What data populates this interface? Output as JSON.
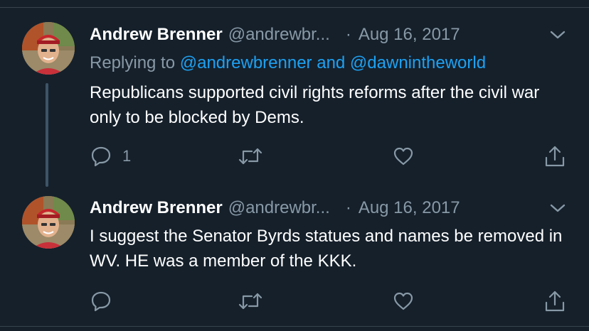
{
  "colors": {
    "background": "#15202b",
    "text": "#ffffff",
    "secondary": "#8899a6",
    "link": "#1da1f2",
    "divider": "#38444d"
  },
  "tweets": [
    {
      "name": "Andrew Brenner",
      "handle": "@andrewbr...",
      "separator": "·",
      "date": "Aug 16, 2017",
      "replying_prefix": "Replying to",
      "replying_users": "@andrewbrenner and @dawnintheworld",
      "text": "Republicans supported civil rights reforms after the civil war only to be blocked by Dems.",
      "reply_count": "1",
      "icons": [
        "avatar",
        "chevron-down-icon",
        "reply-icon",
        "retweet-icon",
        "like-icon",
        "share-icon"
      ]
    },
    {
      "name": "Andrew Brenner",
      "handle": "@andrewbr...",
      "separator": "·",
      "date": "Aug 16, 2017",
      "text": "I suggest the Senator Byrds statues and names be removed in WV. HE was a member of the KKK.",
      "reply_count": "",
      "icons": [
        "avatar",
        "chevron-down-icon",
        "reply-icon",
        "retweet-icon",
        "like-icon",
        "share-icon"
      ]
    }
  ]
}
